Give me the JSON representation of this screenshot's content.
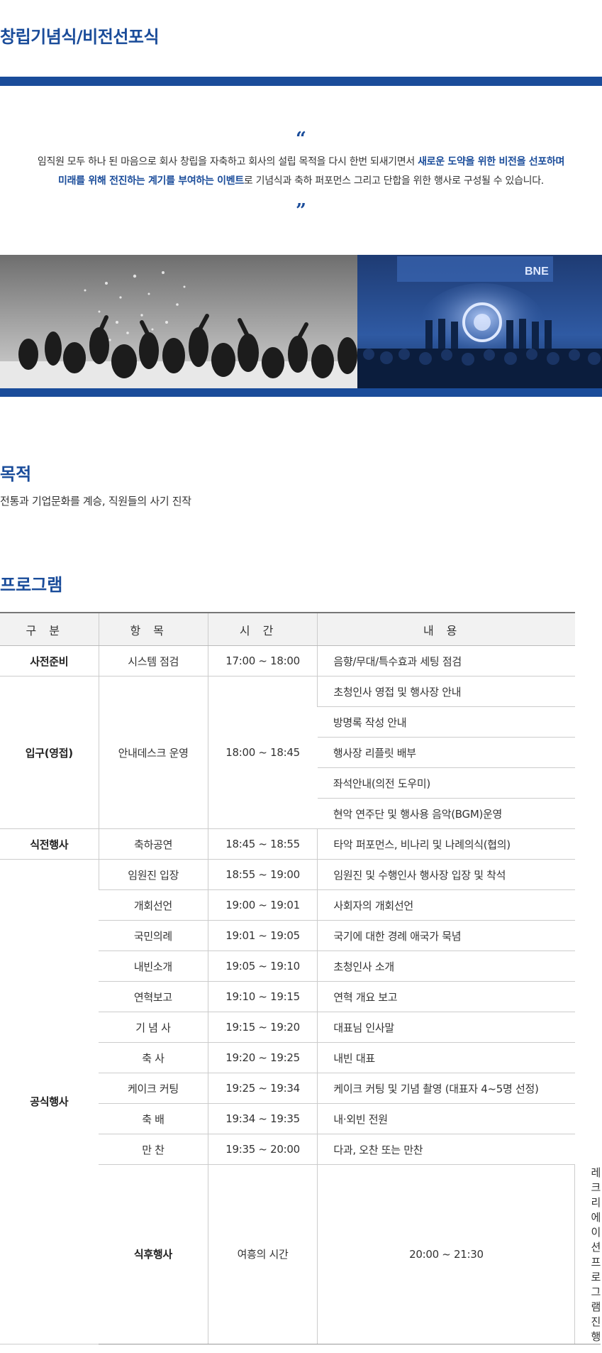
{
  "page": {
    "title": "창립기념식/비전선포식"
  },
  "intro": {
    "open_quote": "“",
    "close_quote": "”",
    "line1_prefix": "임직원 모두 하나 된 마음으로 회사 창립을 자축하고 회사의 설립 목적을 다시 한번 되새기면서 ",
    "line1_highlight": "새로운 도약을 위한 비전을 선포하며",
    "line2_highlight": "미래를 위해 전진하는 계기를 부여하는 이벤트",
    "line2_suffix": "로 기념식과 축하 퍼포먼스 그리고 단합을 위한 행사로 구성될 수 있습니다."
  },
  "photos": {
    "left_description_icon": "celebration-photo",
    "right_banner_text": "BNE"
  },
  "purpose": {
    "heading": "목적",
    "text": "전통과 기업문화를 계승, 직원들의 사기 진작"
  },
  "program": {
    "heading": "프로그램",
    "headers": [
      "구분",
      "항목",
      "시간",
      "내용"
    ],
    "rows": [
      {
        "category": "사전준비",
        "item": "시스템 점검",
        "time": "17:00 ~ 18:00",
        "content": "음향/무대/특수효과 세팅 점검"
      },
      {
        "category": "입구(영접)",
        "item": "안내데스크 운영",
        "time": "18:00 ~ 18:45",
        "content": "초청인사 영접 및 행사장 안내"
      },
      {
        "category": "",
        "item": "",
        "time": "",
        "content": "방명록 작성 안내"
      },
      {
        "category": "",
        "item": "",
        "time": "",
        "content": "행사장 리플릿 배부"
      },
      {
        "category": "",
        "item": "",
        "time": "",
        "content": "좌석안내(의전 도우미)"
      },
      {
        "category": "",
        "item": "",
        "time": "",
        "content": "현악 연주단 및 행사용 음악(BGM)운영"
      },
      {
        "category": "식전행사",
        "item": "축하공연",
        "time": "18:45 ~ 18:55",
        "content": "타악 퍼포먼스, 비나리 및 나례의식(협의)"
      },
      {
        "category": "",
        "item": "임원진 입장",
        "time": "18:55 ~ 19:00",
        "content": "임원진 및 수행인사 행사장 입장 및 착석"
      },
      {
        "category": "",
        "item": "개회선언",
        "time": "19:00 ~ 19:01",
        "content": "사회자의 개회선언"
      },
      {
        "category": "",
        "item": "국민의례",
        "time": "19:01 ~ 19:05",
        "content": "국기에 대한 경례 애국가 묵념"
      },
      {
        "category": "",
        "item": "내빈소개",
        "time": "19:05 ~ 19:10",
        "content": "초청인사 소개"
      },
      {
        "category": "",
        "item": "연혁보고",
        "time": "19:10 ~ 19:15",
        "content": "연혁 개요 보고"
      },
      {
        "category": "공식행사",
        "item": "기 념 사",
        "time": "19:15 ~ 19:20",
        "content": "대표님 인사말"
      },
      {
        "category": "",
        "item": "축 사",
        "time": "19:20 ~ 19:25",
        "content": "내빈 대표"
      },
      {
        "category": "",
        "item": "케이크 커팅",
        "time": "19:25 ~ 19:34",
        "content": "케이크 커팅 및 기념 촬영 (대표자 4~5명 선정)"
      },
      {
        "category": "",
        "item": "축 배",
        "time": "19:34 ~ 19:35",
        "content": "내·외빈 전원"
      },
      {
        "category": "",
        "item": "만 찬",
        "time": "19:35 ~ 20:00",
        "content": "다과, 오찬 또는 만찬"
      },
      {
        "category": "식후행사",
        "item": "여흥의 시간",
        "time": "20:00 ~ 21:30",
        "content": "레크리에이션 프로그램 진행"
      }
    ]
  }
}
